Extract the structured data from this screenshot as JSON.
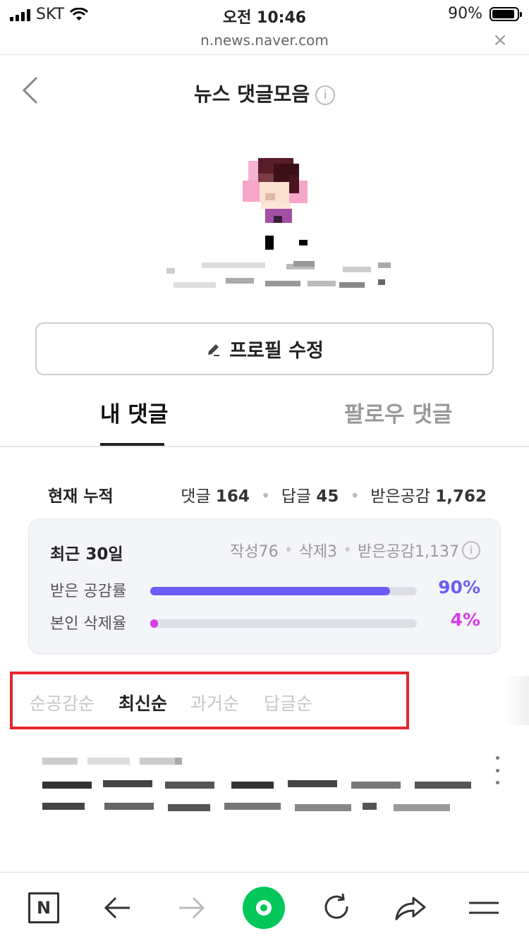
{
  "status_bar": {
    "carrier": "SKT",
    "time": "오전 10:46",
    "battery_percent": "90%",
    "battery_level": 0.9
  },
  "browser": {
    "url": "n.news.naver.com",
    "close_label": "×"
  },
  "header": {
    "title": "뉴스 댓글모음",
    "info_glyph": "i"
  },
  "profile": {
    "edit_button_label": "프로필 수정"
  },
  "tabs": [
    {
      "label": "내 댓글",
      "active": true
    },
    {
      "label": "팔로우 댓글",
      "active": false
    }
  ],
  "cumulative": {
    "label": "현재 누적",
    "comments_label": "댓글",
    "comments_value": "164",
    "replies_label": "답글",
    "replies_value": "45",
    "likes_label": "받은공감",
    "likes_value": "1,762"
  },
  "recent": {
    "title": "최근 30일",
    "written": "작성76",
    "deleted": "삭제3",
    "likes": "받은공감1,137",
    "info_glyph": "i",
    "metrics": [
      {
        "label": "받은 공감률",
        "value": "90%",
        "fraction": 0.9,
        "color": "#6b5cf6"
      },
      {
        "label": "본인 삭제율",
        "value": "4%",
        "fraction": 0.02,
        "color": "#d63ee8"
      }
    ]
  },
  "sort_options": [
    {
      "label": "순공감순",
      "active": false
    },
    {
      "label": "최신순",
      "active": true
    },
    {
      "label": "과거순",
      "active": false
    },
    {
      "label": "답글순",
      "active": false
    }
  ],
  "icons": {
    "back": "chevron-left-icon",
    "edit": "pencil-icon",
    "naver_home": "naver-n-icon",
    "nav_back": "arrow-left-icon",
    "nav_forward": "arrow-right-icon",
    "green_dot": "green-dot-icon",
    "reload": "reload-icon",
    "share": "share-icon",
    "menu": "menu-icon",
    "more": "more-vertical-icon"
  },
  "colors": {
    "accent_purple": "#6b5cf6",
    "accent_magenta": "#d63ee8",
    "naver_green": "#03c75a",
    "highlight_red": "#e6262f"
  },
  "bottom_bar": {
    "naver_letter": "N"
  }
}
